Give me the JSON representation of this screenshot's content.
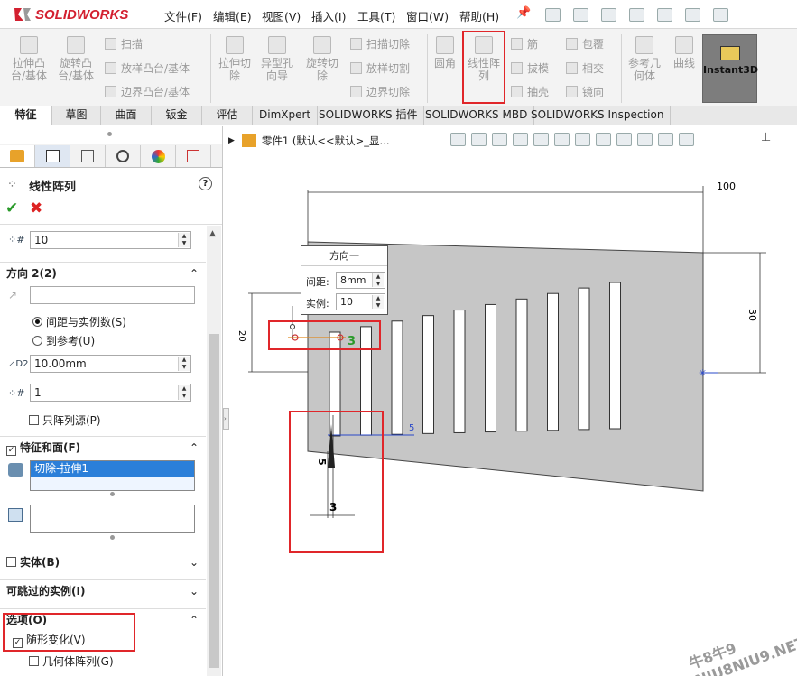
{
  "app": {
    "logo": "SOLIDWORKS"
  },
  "menu": [
    "文件(F)",
    "编辑(E)",
    "视图(V)",
    "插入(I)",
    "工具(T)",
    "窗口(W)",
    "帮助(H)"
  ],
  "ribbon": {
    "big": [
      "拉伸凸台/基体",
      "旋转凸台/基体",
      "拉伸切除",
      "异型孔向导",
      "旋转切除",
      "圆角",
      "线性阵列",
      "参考几何体",
      "曲线",
      "Instant3D"
    ],
    "small": [
      "扫描",
      "放样凸台/基体",
      "边界凸台/基体",
      "扫描切除",
      "放样切割",
      "边界切除",
      "筋",
      "拔模",
      "抽壳",
      "包覆",
      "相交",
      "镜向"
    ]
  },
  "tabs": [
    "特征",
    "草图",
    "曲面",
    "钣金",
    "评估",
    "DimXpert",
    "SOLIDWORKS 插件",
    "SOLIDWORKS MBD",
    "SOLIDWORKS Inspection"
  ],
  "panel": {
    "title": "线性阵列",
    "help": "?",
    "instances1": "10",
    "direction2": "方向 2(2)",
    "spacing_mode": "间距与实例数(S)",
    "to_ref_mode": "到参考(U)",
    "spacing2": "10.00mm",
    "instances2": "1",
    "seed_only": "只阵列源(P)",
    "features_faces": "特征和面(F)",
    "feature_item": "切除-拉伸1",
    "bodies": "实体(B)",
    "skip": "可跳过的实例(I)",
    "options": "选项(O)",
    "vary": "随形变化(V)",
    "geometry": "几何体阵列(G)"
  },
  "graphics": {
    "breadcrumb": "零件1 (默认<<默认>_显...",
    "callout_title": "方向一",
    "callout_spacing_label": "间距:",
    "callout_spacing_value": "8mm",
    "callout_inst_label": "实例:",
    "callout_inst_value": "10",
    "dims": {
      "d100": "100",
      "d30": "30",
      "d20": "20",
      "d3a": "3",
      "d5a": "5",
      "d5b": "5",
      "d3b": "3"
    }
  },
  "watermark": "牛8牛9 NIU8NIU9.NET",
  "colors": {
    "accent": "#e0262a",
    "brand": "#d32030",
    "selection": "#2b7fd9"
  }
}
